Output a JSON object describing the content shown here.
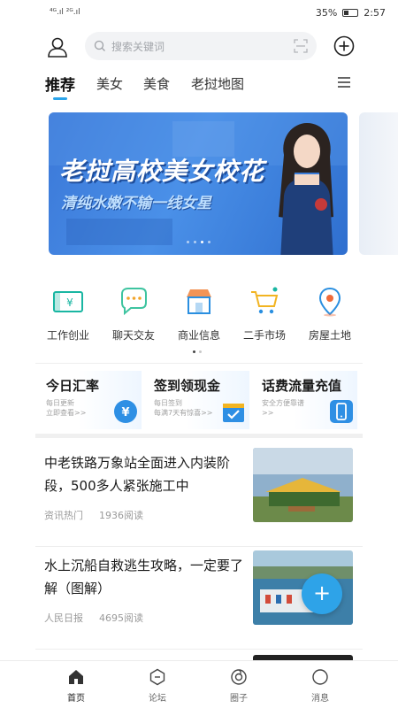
{
  "status_bar": {
    "network": "⁴ᴳ.ıl ²ᴳ.ıl",
    "battery": "35%",
    "time": "2:57"
  },
  "header": {
    "avatar_icon": "user-icon",
    "search_placeholder": "搜索关键词",
    "scan_icon": "scan-icon",
    "add_icon": "plus-circle-icon"
  },
  "tabs": [
    {
      "label": "推荐",
      "active": true
    },
    {
      "label": "美女",
      "active": false
    },
    {
      "label": "美食",
      "active": false
    },
    {
      "label": "老挝地图",
      "active": false
    }
  ],
  "banner": {
    "title": "老挝高校美女校花",
    "subtitle": "清纯水嫩不输一线女星",
    "dot_count": 4,
    "active_dot": 3
  },
  "grid": [
    {
      "label": "工作创业",
      "icon": "money-card-icon",
      "color": "#19b6a2"
    },
    {
      "label": "聊天交友",
      "icon": "chat-bubble-icon",
      "color": "#3ec4a0"
    },
    {
      "label": "商业信息",
      "icon": "shop-icon",
      "color": "#2a8fe0"
    },
    {
      "label": "二手市场",
      "icon": "cart-icon",
      "color": "#f2b422"
    },
    {
      "label": "房屋土地",
      "icon": "location-pin-icon",
      "color": "#ef6b3a"
    }
  ],
  "cards": [
    {
      "title": "今日汇率",
      "sub1": "每日更新",
      "sub2": "立即查看>>",
      "icon": "yuan-icon"
    },
    {
      "title": "签到领现金",
      "sub1": "每日签到",
      "sub2": "每满7天有惊喜>>",
      "icon": "calendar-check-icon"
    },
    {
      "title": "话费流量充值",
      "sub1": "安全方便靠谱",
      "sub2": ">>",
      "icon": "phone-icon"
    }
  ],
  "news": [
    {
      "title": "中老铁路万象站全面进入内装阶段，500多人紧张施工中",
      "source": "资讯热门",
      "reads": "1936阅读"
    },
    {
      "title": "水上沉船自救逃生攻略，一定要了解（图解）",
      "source": "人民日报",
      "reads": "4695阅读"
    }
  ],
  "fab": {
    "label": "+"
  },
  "bottom_nav": [
    {
      "label": "首页",
      "icon": "home-icon",
      "active": true
    },
    {
      "label": "论坛",
      "icon": "forum-icon",
      "active": false
    },
    {
      "label": "圈子",
      "icon": "circle-icon",
      "active": false
    },
    {
      "label": "消息",
      "icon": "message-icon",
      "active": false
    }
  ],
  "colors": {
    "accent": "#2aa4ea",
    "banner": "#3b78d8"
  }
}
